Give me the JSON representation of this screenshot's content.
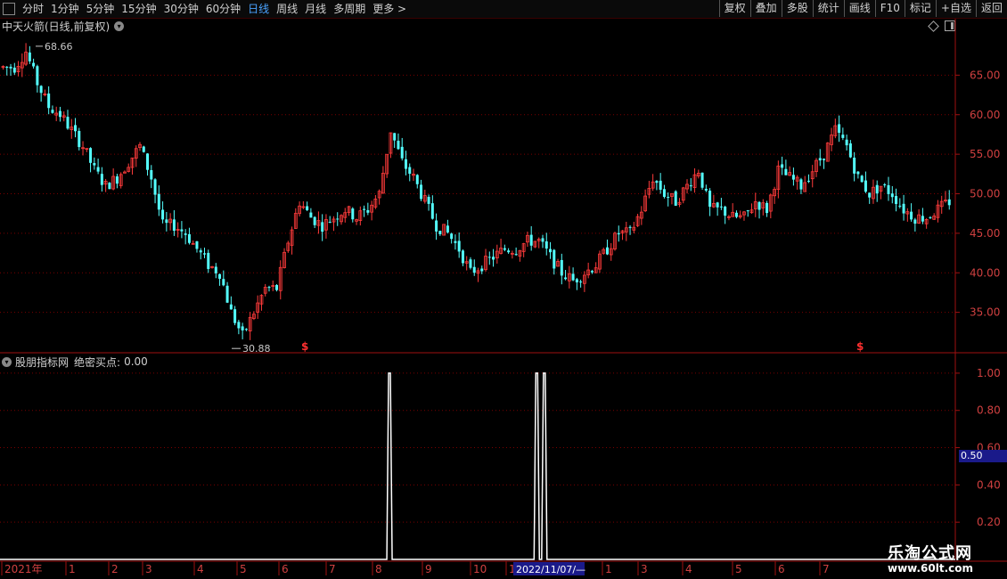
{
  "toolbar": {
    "periods": [
      {
        "label": "分时",
        "active": false
      },
      {
        "label": "1分钟",
        "active": false
      },
      {
        "label": "5分钟",
        "active": false
      },
      {
        "label": "15分钟",
        "active": false
      },
      {
        "label": "30分钟",
        "active": false
      },
      {
        "label": "60分钟",
        "active": false
      },
      {
        "label": "日线",
        "active": true
      },
      {
        "label": "周线",
        "active": false
      },
      {
        "label": "月线",
        "active": false
      },
      {
        "label": "多周期",
        "active": false
      },
      {
        "label": "更多 >",
        "active": false
      }
    ],
    "buttons": [
      "复权",
      "叠加",
      "多股",
      "统计",
      "画线",
      "F10",
      "标记",
      "+自选",
      "返回"
    ]
  },
  "main_chart": {
    "title": "中天火箭(日线,前复权)",
    "high_marker": "68.66",
    "low_marker": "30.88",
    "signal_symbol": "$",
    "y_ticks": [
      "65.00",
      "60.00",
      "55.00",
      "50.00",
      "45.00",
      "40.00",
      "35.00"
    ]
  },
  "indicator_panel": {
    "label": "股朋指标网",
    "indicator_name": "绝密买点:",
    "indicator_value": "0.00",
    "y_ticks": [
      "1.00",
      "0.80",
      "0.60",
      "0.40",
      "0.20"
    ],
    "current_value_tag": "0.50"
  },
  "time_axis": {
    "labels": [
      "2021年",
      "1",
      "2",
      "3",
      "4",
      "5",
      "6",
      "7",
      "8",
      "9",
      "10",
      "1",
      "1",
      "3",
      "4",
      "5",
      "6",
      "7"
    ],
    "cursor_date": "2022/11/07/—"
  },
  "watermark": {
    "name": "乐淘公式网",
    "url": "www.60lt.com"
  },
  "colors": {
    "up": "#ff3b3b",
    "down": "#54ffff",
    "grid": "#7a0000",
    "axis": "#a01010",
    "active_tab": "#4aa3ff",
    "indicator_line": "#ffffff"
  },
  "chart_data": {
    "type": "candlestick",
    "x_start": "2021",
    "ylim": [
      30,
      70
    ],
    "price_path": [
      [
        66,
        65
      ],
      [
        66,
        67
      ],
      [
        68,
        68.66
      ],
      [
        64,
        64
      ],
      [
        61,
        60
      ],
      [
        60,
        61
      ],
      [
        58,
        57
      ],
      [
        56,
        56
      ],
      [
        53,
        53
      ],
      [
        51,
        51
      ],
      [
        52,
        52
      ],
      [
        54,
        54
      ],
      [
        56,
        56
      ],
      [
        52,
        52
      ],
      [
        46,
        46
      ],
      [
        46,
        46
      ],
      [
        45,
        45
      ],
      [
        43,
        43
      ],
      [
        41,
        41
      ],
      [
        40,
        40
      ],
      [
        35,
        35
      ],
      [
        32,
        30.88
      ],
      [
        35,
        35
      ],
      [
        38,
        38
      ],
      [
        38,
        38
      ],
      [
        44,
        44
      ],
      [
        49,
        49
      ],
      [
        47,
        47
      ],
      [
        46,
        46
      ],
      [
        47,
        47
      ],
      [
        48,
        48
      ],
      [
        47,
        47
      ],
      [
        48,
        48
      ],
      [
        50,
        50
      ],
      [
        58,
        58
      ],
      [
        54,
        54
      ],
      [
        52,
        52
      ],
      [
        49,
        49
      ],
      [
        46,
        46
      ],
      [
        45,
        45
      ],
      [
        43,
        43
      ],
      [
        40,
        40
      ],
      [
        41,
        41
      ],
      [
        42,
        42
      ],
      [
        43,
        43
      ],
      [
        43,
        43
      ],
      [
        44,
        44
      ],
      [
        44,
        44
      ],
      [
        42,
        42
      ],
      [
        40,
        40
      ],
      [
        39,
        39
      ],
      [
        40,
        40
      ],
      [
        41,
        41
      ],
      [
        43,
        43
      ],
      [
        45,
        45
      ],
      [
        45,
        45
      ],
      [
        48,
        48
      ],
      [
        52,
        52
      ],
      [
        50,
        50
      ],
      [
        49,
        49
      ],
      [
        51,
        51
      ],
      [
        53,
        53
      ],
      [
        48,
        48
      ],
      [
        48,
        48
      ],
      [
        47,
        47
      ],
      [
        47,
        47
      ],
      [
        49,
        49
      ],
      [
        48,
        48
      ],
      [
        53,
        53
      ],
      [
        52,
        52
      ],
      [
        51,
        51
      ],
      [
        53,
        53
      ],
      [
        55,
        55
      ],
      [
        58,
        58
      ],
      [
        56,
        56
      ],
      [
        52,
        52
      ],
      [
        50,
        50
      ],
      [
        51,
        51
      ],
      [
        50,
        50
      ],
      [
        48,
        48
      ],
      [
        47,
        47
      ],
      [
        47,
        47
      ],
      [
        48,
        48
      ],
      [
        49,
        49
      ]
    ],
    "indicator": {
      "name": "绝密买点",
      "ylim": [
        0,
        1.1
      ],
      "spikes": [
        {
          "x_index": 0.41,
          "value": 1.0
        },
        {
          "x_index": 0.565,
          "value": 1.0
        },
        {
          "x_index": 0.573,
          "value": 1.0
        }
      ]
    }
  }
}
